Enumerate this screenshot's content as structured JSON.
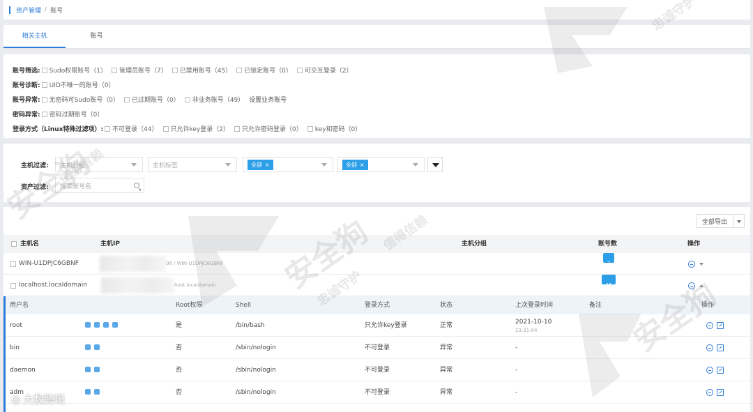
{
  "breadcrumb": {
    "root": "资产管理",
    "separator": "/",
    "current": "账号"
  },
  "tabs": [
    {
      "label": "相关主机"
    },
    {
      "label": "账号"
    }
  ],
  "filters": {
    "account_filter": {
      "label": "账号筛选:",
      "options": [
        {
          "label": "Sudo权限账号（1）"
        },
        {
          "label": "管理员账号（7）"
        },
        {
          "label": "已禁用账号（45）"
        },
        {
          "label": "已锁定账号（0）"
        },
        {
          "label": "可交互登录（2）"
        }
      ]
    },
    "account_diag": {
      "label": "账号诊断:",
      "options": [
        {
          "label": "UID不唯一的账号（0）"
        }
      ]
    },
    "account_abnormal": {
      "label": "账号异常:",
      "options": [
        {
          "label": "无密码可Sudo账号（0）"
        },
        {
          "label": "已过期账号（0）"
        },
        {
          "label": "非业务账号（49）"
        }
      ],
      "link": "设置业务账号"
    },
    "password_abnormal": {
      "label": "密码异常:",
      "options": [
        {
          "label": "密码过期账号（0）"
        }
      ]
    },
    "login_method": {
      "label": "登录方式（Linux特殊过滤项）:",
      "options": [
        {
          "label": "不可登录（44）"
        },
        {
          "label": "只允许key登录（2）"
        },
        {
          "label": "只允许密码登录（0）"
        },
        {
          "label": "key和密码（0）"
        }
      ]
    }
  },
  "host_filter": {
    "label": "主机过滤:",
    "group_placeholder": "主机分组",
    "tag_placeholder": "主机标签",
    "tag1": "全部",
    "tag2": "全部",
    "asset_label": "资产过滤:",
    "search_placeholder": "搜索账号名"
  },
  "export_label": "全部导出",
  "host_table": {
    "headers": {
      "name": "主机名",
      "ip": "主机IP",
      "group": "主机分组",
      "count": "账号数",
      "ops": "操作"
    },
    "rows": [
      {
        "name": "WIN-U1DPJC6GBNF",
        "ip_tail": "06 / WIN-U1DPJC6GBNF",
        "count": "3"
      },
      {
        "name": "localhost.localdomain",
        "ip_tail": "host.localdomain",
        "count": "46"
      }
    ]
  },
  "account_table": {
    "headers": {
      "user": "用户名",
      "root": "Root权限",
      "shell": "Shell",
      "login": "登录方式",
      "status": "状态",
      "last_login": "上次登录时间",
      "remark": "备注",
      "ops": "操作"
    },
    "rows": [
      {
        "user": "root",
        "root": "是",
        "shell": "/bin/bash",
        "login": "只允许key登录",
        "status": "正常",
        "last_login": "2021-10-10",
        "last_time": "23:31:04",
        "icons": 4
      },
      {
        "user": "bin",
        "root": "否",
        "shell": "/sbin/nologin",
        "login": "不可登录",
        "status": "异常",
        "last_login": "-",
        "last_time": "",
        "icons": 2
      },
      {
        "user": "daemon",
        "root": "否",
        "shell": "/sbin/nologin",
        "login": "不可登录",
        "status": "异常",
        "last_login": "-",
        "last_time": "",
        "icons": 2
      },
      {
        "user": "adm",
        "root": "否",
        "shell": "/sbin/nologin",
        "login": "不可登录",
        "status": "异常",
        "last_login": "-",
        "last_time": "",
        "icons": 2
      }
    ]
  },
  "watermark": {
    "brand": "安全狗",
    "slogan1": "值得信赖",
    "slogan2": "忠诚守护"
  },
  "brand_footer": "大数跨境",
  "colors": {
    "accent": "#2d7bd8",
    "badge": "#2d9fe8"
  }
}
